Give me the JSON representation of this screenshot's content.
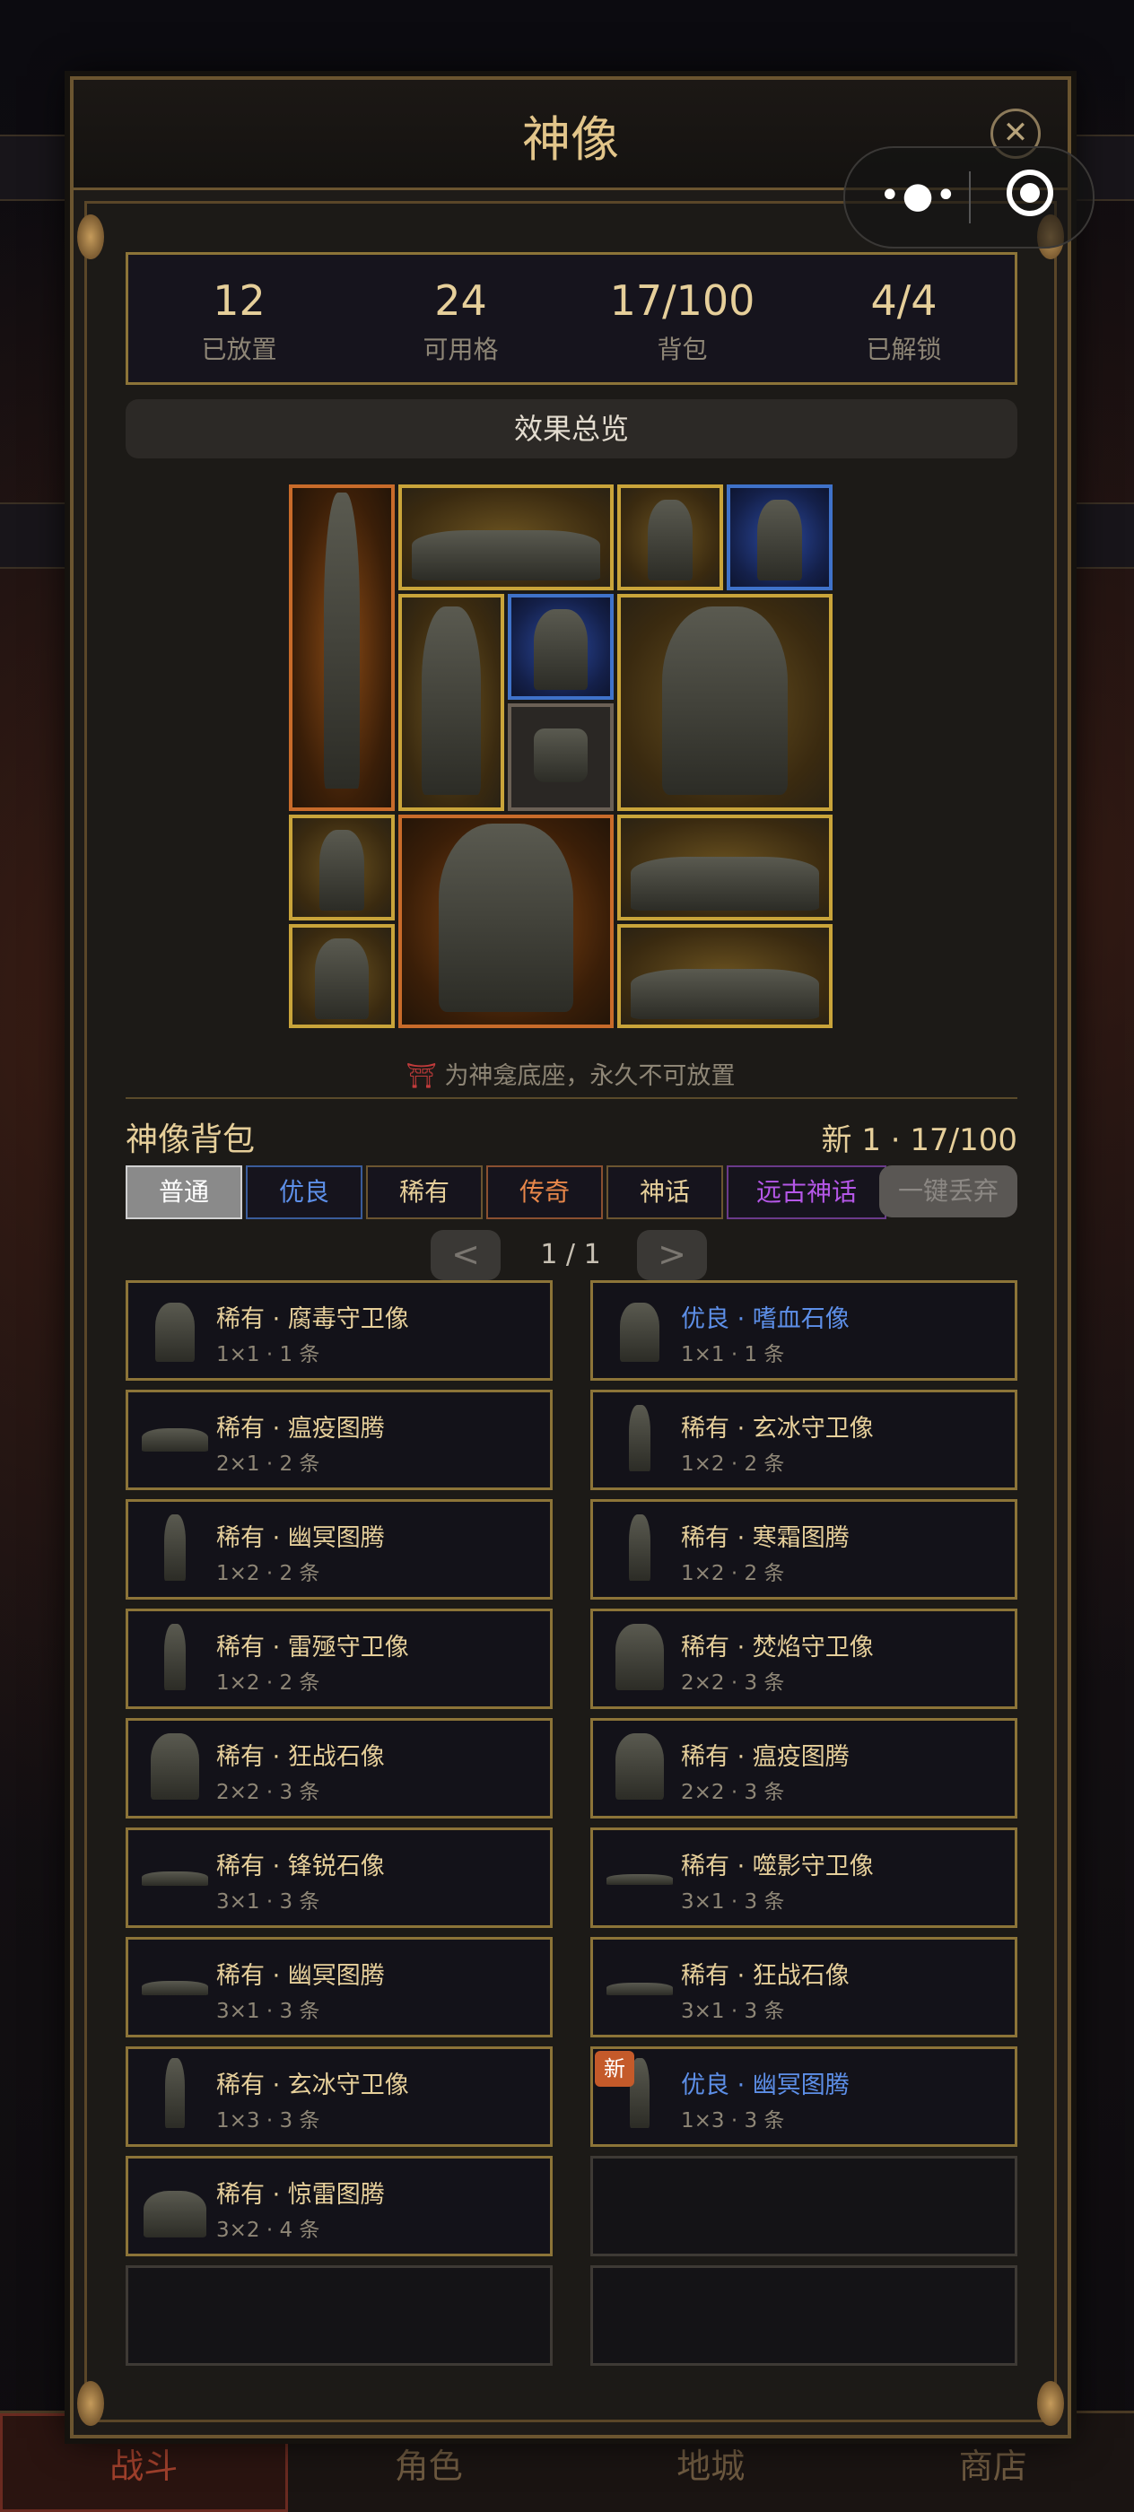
{
  "background": {
    "tabs": [
      "战斗",
      "角色",
      "地城",
      "商店"
    ]
  },
  "modal": {
    "title": "神像",
    "close_icon": "close-icon"
  },
  "capsule": {
    "more_icon": "more-dots-icon",
    "exit_icon": "target-icon"
  },
  "stats": [
    {
      "value": "12",
      "label": "已放置"
    },
    {
      "value": "24",
      "label": "可用格"
    },
    {
      "value": "17/100",
      "label": "背包"
    },
    {
      "value": "4/4",
      "label": "已解锁"
    }
  ],
  "summary_button": "效果总览",
  "grid_cells": [
    {
      "rarity": "legendary",
      "kind": "standing statue"
    },
    {
      "rarity": "rare",
      "kind": "reclining statue"
    },
    {
      "rarity": "rare",
      "kind": "hooded statue"
    },
    {
      "rarity": "good",
      "kind": "hooded statue"
    },
    {
      "rarity": "rare",
      "kind": "hooded statue"
    },
    {
      "rarity": "good",
      "kind": "knight bust"
    },
    {
      "rarity": "rare",
      "kind": "seated hooded statue"
    },
    {
      "rarity": "base",
      "kind": "shrine base"
    },
    {
      "rarity": "rare",
      "kind": "hooded statue"
    },
    {
      "rarity": "legendary",
      "kind": "shrine statue"
    },
    {
      "rarity": "rare",
      "kind": "reclining statue"
    },
    {
      "rarity": "rare",
      "kind": "knight bust"
    },
    {
      "rarity": "rare",
      "kind": "reclining statue"
    }
  ],
  "base_note": {
    "icon": "⛩",
    "text": "为神龛底座，永久不可放置"
  },
  "bag": {
    "title": "神像背包",
    "count": "新 1 · 17/100",
    "filters": [
      "普通",
      "优良",
      "稀有",
      "传奇",
      "神话",
      "远古神话"
    ],
    "discard": "一键丢弃",
    "prev": "<",
    "page": "1 / 1",
    "next": ">"
  },
  "items": [
    {
      "name": "稀有 · 腐毒守卫像",
      "meta": "1×1 · 1 条",
      "quality": "rare"
    },
    {
      "name": "优良 · 嗜血石像",
      "meta": "1×1 · 1 条",
      "quality": "good"
    },
    {
      "name": "稀有 · 瘟疫图腾",
      "meta": "2×1 · 2 条",
      "quality": "rare"
    },
    {
      "name": "稀有 · 玄冰守卫像",
      "meta": "1×2 · 2 条",
      "quality": "rare"
    },
    {
      "name": "稀有 · 幽冥图腾",
      "meta": "1×2 · 2 条",
      "quality": "rare"
    },
    {
      "name": "稀有 · 寒霜图腾",
      "meta": "1×2 · 2 条",
      "quality": "rare"
    },
    {
      "name": "稀有 · 雷殛守卫像",
      "meta": "1×2 · 2 条",
      "quality": "rare"
    },
    {
      "name": "稀有 · 焚焰守卫像",
      "meta": "2×2 · 3 条",
      "quality": "rare"
    },
    {
      "name": "稀有 · 狂战石像",
      "meta": "2×2 · 3 条",
      "quality": "rare"
    },
    {
      "name": "稀有 · 瘟疫图腾",
      "meta": "2×2 · 3 条",
      "quality": "rare"
    },
    {
      "name": "稀有 · 锋锐石像",
      "meta": "3×1 · 3 条",
      "quality": "rare"
    },
    {
      "name": "稀有 · 噬影守卫像",
      "meta": "3×1 · 3 条",
      "quality": "rare"
    },
    {
      "name": "稀有 · 幽冥图腾",
      "meta": "3×1 · 3 条",
      "quality": "rare"
    },
    {
      "name": "稀有 · 狂战石像",
      "meta": "3×1 · 3 条",
      "quality": "rare"
    },
    {
      "name": "稀有 · 玄冰守卫像",
      "meta": "1×3 · 3 条",
      "quality": "rare"
    },
    {
      "name": "优良 · 幽冥图腾",
      "meta": "1×3 · 3 条",
      "quality": "good",
      "badge": "新"
    },
    {
      "name": "稀有 · 惊雷图腾",
      "meta": "3×2 · 4 条",
      "quality": "rare"
    }
  ]
}
